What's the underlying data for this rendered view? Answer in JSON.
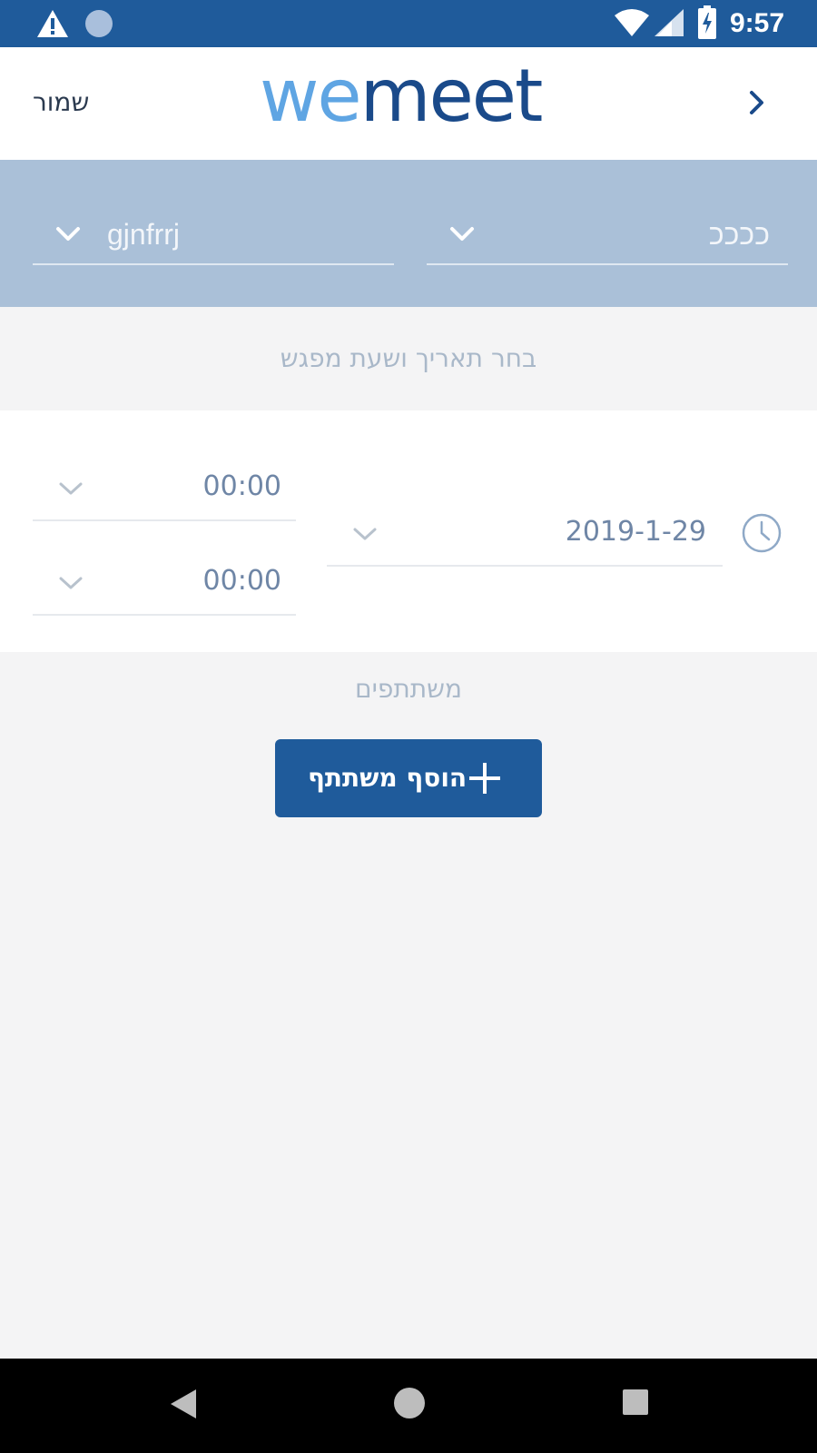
{
  "status_bar": {
    "time": "9:57",
    "icons": [
      "warning-icon",
      "status-dot-icon",
      "wifi-icon",
      "signal-icon",
      "battery-charging-icon"
    ]
  },
  "header": {
    "save_label": "שמור",
    "logo_part1": "we",
    "logo_part2": "meet",
    "back_icon": "chevron-right-icon"
  },
  "filters": {
    "left_value": "gjnfrrj",
    "right_value": "ככככ"
  },
  "date_section": {
    "title": "בחר תאריך ושעת מפגש",
    "date_value": "2019-1-29",
    "start_time": "00:00",
    "end_time": "00:00"
  },
  "participants": {
    "title": "משתתפים",
    "add_button_label": "הוסף משתתף"
  },
  "colors": {
    "status_bar": "#1f5b9b",
    "accent": "#1f5b9b",
    "filter_band": "#aac0d8",
    "logo_light": "#5fa5e3",
    "logo_dark": "#1a4a8a"
  },
  "nav_bar": {
    "icons": [
      "nav-back-icon",
      "nav-home-icon",
      "nav-recent-icon"
    ]
  }
}
